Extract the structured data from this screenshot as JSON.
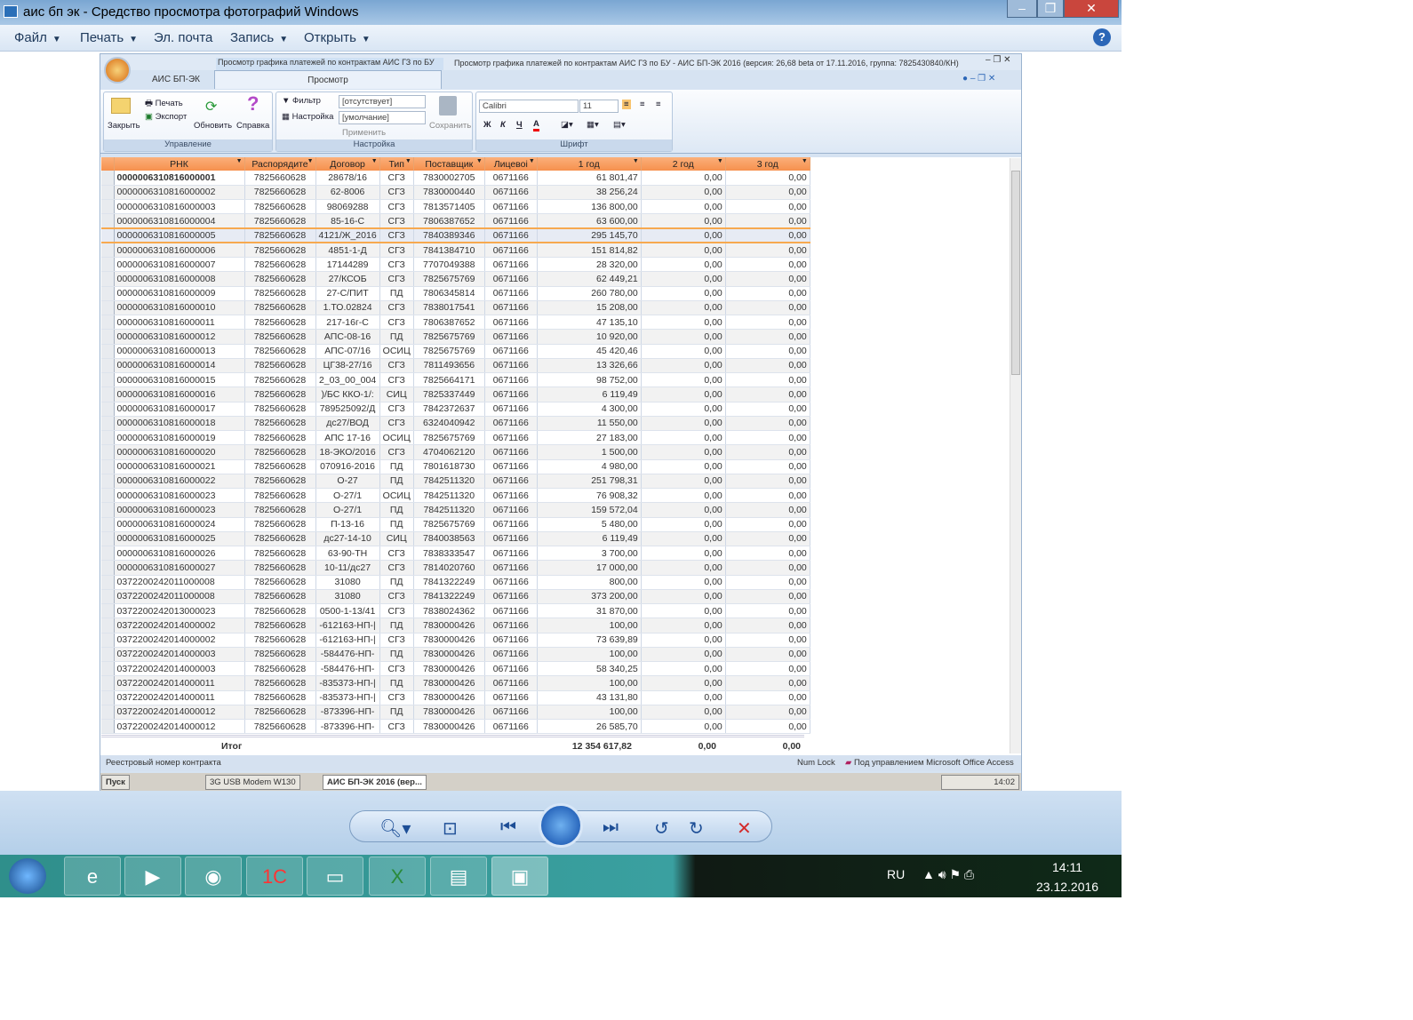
{
  "viewer": {
    "title": "аис бп эк - Средство просмотра фотографий Windows",
    "menu": [
      {
        "label": "Файл"
      },
      {
        "label": "Печать"
      },
      {
        "label": "Эл. почта"
      },
      {
        "label": "Запись"
      },
      {
        "label": "Открыть"
      }
    ]
  },
  "access": {
    "title_left": "Просмотр графика платежей по контрактам АИС ГЗ по БУ",
    "title_full": "Просмотр графика платежей по контрактам АИС ГЗ по БУ - АИС БП-ЭК 2016 (версия: 26,68 beta от 17.11.2016, группа: 7825430840/КН)",
    "tabs": [
      "АИС БП-ЭК",
      "Просмотр"
    ],
    "ribbon": {
      "manage": {
        "label": "Управление",
        "close": "Закрыть",
        "print": "Печать",
        "export": "Экспорт",
        "refresh": "Обновить",
        "help": "Справка"
      },
      "settings": {
        "label": "Настройка",
        "filter": "Фильтр",
        "filter_value": "[отсутствует]",
        "setup": "Настройка",
        "setup_value": "[умолчание]",
        "apply": "Применить",
        "save": "Сохранить"
      },
      "font": {
        "label": "Шрифт",
        "name": "Calibri",
        "size": "11",
        "bold": "Ж",
        "italic": "К",
        "underline": "Ч",
        "color": "А"
      }
    },
    "columns": [
      "РНК",
      "Распорядите",
      "Договор",
      "Тип",
      "Поставщик",
      "Лицевоі",
      "1 год",
      "2 год",
      "3 год"
    ],
    "rows": [
      [
        "0000006310816000001",
        "7825660628",
        "28678/16",
        "СГЗ",
        "7830002705",
        "0671166",
        "61 801,47",
        "0,00",
        "0,00"
      ],
      [
        "0000006310816000002",
        "7825660628",
        "62-8006",
        "СГЗ",
        "7830000440",
        "0671166",
        "38 256,24",
        "0,00",
        "0,00"
      ],
      [
        "0000006310816000003",
        "7825660628",
        "98069288",
        "СГЗ",
        "7813571405",
        "0671166",
        "136 800,00",
        "0,00",
        "0,00"
      ],
      [
        "0000006310816000004",
        "7825660628",
        "85-16-С",
        "СГЗ",
        "7806387652",
        "0671166",
        "63 600,00",
        "0,00",
        "0,00"
      ],
      [
        "0000006310816000005",
        "7825660628",
        "4121/Ж_2016",
        "СГЗ",
        "7840389346",
        "0671166",
        "295 145,70",
        "0,00",
        "0,00"
      ],
      [
        "0000006310816000006",
        "7825660628",
        "4851-1-Д",
        "СГЗ",
        "7841384710",
        "0671166",
        "151 814,82",
        "0,00",
        "0,00"
      ],
      [
        "0000006310816000007",
        "7825660628",
        "17144289",
        "СГЗ",
        "7707049388",
        "0671166",
        "28 320,00",
        "0,00",
        "0,00"
      ],
      [
        "0000006310816000008",
        "7825660628",
        "27/КСОБ",
        "СГЗ",
        "7825675769",
        "0671166",
        "62 449,21",
        "0,00",
        "0,00"
      ],
      [
        "0000006310816000009",
        "7825660628",
        "27-С/ПИТ",
        "ПД",
        "7806345814",
        "0671166",
        "260 780,00",
        "0,00",
        "0,00"
      ],
      [
        "0000006310816000010",
        "7825660628",
        "1.ТО.02824",
        "СГЗ",
        "7838017541",
        "0671166",
        "15 208,00",
        "0,00",
        "0,00"
      ],
      [
        "0000006310816000011",
        "7825660628",
        "217-16г-С",
        "СГЗ",
        "7806387652",
        "0671166",
        "47 135,10",
        "0,00",
        "0,00"
      ],
      [
        "0000006310816000012",
        "7825660628",
        "АПС-08-16",
        "ПД",
        "7825675769",
        "0671166",
        "10 920,00",
        "0,00",
        "0,00"
      ],
      [
        "0000006310816000013",
        "7825660628",
        "АПС-07/16",
        "ОСИЦ",
        "7825675769",
        "0671166",
        "45 420,46",
        "0,00",
        "0,00"
      ],
      [
        "0000006310816000014",
        "7825660628",
        "ЦГ38-27/16",
        "СГЗ",
        "7811493656",
        "0671166",
        "13 326,66",
        "0,00",
        "0,00"
      ],
      [
        "0000006310816000015",
        "7825660628",
        "2_03_00_004",
        "СГЗ",
        "7825664171",
        "0671166",
        "98 752,00",
        "0,00",
        "0,00"
      ],
      [
        "0000006310816000016",
        "7825660628",
        ")/БС ККО-1/:",
        "СИЦ",
        "7825337449",
        "0671166",
        "6 119,49",
        "0,00",
        "0,00"
      ],
      [
        "0000006310816000017",
        "7825660628",
        "789525092/Д",
        "СГЗ",
        "7842372637",
        "0671166",
        "4 300,00",
        "0,00",
        "0,00"
      ],
      [
        "0000006310816000018",
        "7825660628",
        "дс27/ВОД",
        "СГЗ",
        "6324040942",
        "0671166",
        "11 550,00",
        "0,00",
        "0,00"
      ],
      [
        "0000006310816000019",
        "7825660628",
        "АПС 17-16",
        "ОСИЦ",
        "7825675769",
        "0671166",
        "27 183,00",
        "0,00",
        "0,00"
      ],
      [
        "0000006310816000020",
        "7825660628",
        "18-ЭКО/2016",
        "СГЗ",
        "4704062120",
        "0671166",
        "1 500,00",
        "0,00",
        "0,00"
      ],
      [
        "0000006310816000021",
        "7825660628",
        "070916-2016",
        "ПД",
        "7801618730",
        "0671166",
        "4 980,00",
        "0,00",
        "0,00"
      ],
      [
        "0000006310816000022",
        "7825660628",
        "О-27",
        "ПД",
        "7842511320",
        "0671166",
        "251 798,31",
        "0,00",
        "0,00"
      ],
      [
        "0000006310816000023",
        "7825660628",
        "О-27/1",
        "ОСИЦ",
        "7842511320",
        "0671166",
        "76 908,32",
        "0,00",
        "0,00"
      ],
      [
        "0000006310816000023",
        "7825660628",
        "О-27/1",
        "ПД",
        "7842511320",
        "0671166",
        "159 572,04",
        "0,00",
        "0,00"
      ],
      [
        "0000006310816000024",
        "7825660628",
        "П-13-16",
        "ПД",
        "7825675769",
        "0671166",
        "5 480,00",
        "0,00",
        "0,00"
      ],
      [
        "0000006310816000025",
        "7825660628",
        "дс27-14-10",
        "СИЦ",
        "7840038563",
        "0671166",
        "6 119,49",
        "0,00",
        "0,00"
      ],
      [
        "0000006310816000026",
        "7825660628",
        "63-90-ТН",
        "СГЗ",
        "7838333547",
        "0671166",
        "3 700,00",
        "0,00",
        "0,00"
      ],
      [
        "0000006310816000027",
        "7825660628",
        "10-11/дс27",
        "СГЗ",
        "7814020760",
        "0671166",
        "17 000,00",
        "0,00",
        "0,00"
      ],
      [
        "0372200242011000008",
        "7825660628",
        "31080",
        "ПД",
        "7841322249",
        "0671166",
        "800,00",
        "0,00",
        "0,00"
      ],
      [
        "0372200242011000008",
        "7825660628",
        "31080",
        "СГЗ",
        "7841322249",
        "0671166",
        "373 200,00",
        "0,00",
        "0,00"
      ],
      [
        "0372200242013000023",
        "7825660628",
        "0500-1-13/41",
        "СГЗ",
        "7838024362",
        "0671166",
        "31 870,00",
        "0,00",
        "0,00"
      ],
      [
        "0372200242014000002",
        "7825660628",
        "-612163-НП-|",
        "ПД",
        "7830000426",
        "0671166",
        "100,00",
        "0,00",
        "0,00"
      ],
      [
        "0372200242014000002",
        "7825660628",
        "-612163-НП-|",
        "СГЗ",
        "7830000426",
        "0671166",
        "73 639,89",
        "0,00",
        "0,00"
      ],
      [
        "0372200242014000003",
        "7825660628",
        "-584476-НП-",
        "ПД",
        "7830000426",
        "0671166",
        "100,00",
        "0,00",
        "0,00"
      ],
      [
        "0372200242014000003",
        "7825660628",
        "-584476-НП-",
        "СГЗ",
        "7830000426",
        "0671166",
        "58 340,25",
        "0,00",
        "0,00"
      ],
      [
        "0372200242014000011",
        "7825660628",
        "-835373-НП-|",
        "ПД",
        "7830000426",
        "0671166",
        "100,00",
        "0,00",
        "0,00"
      ],
      [
        "0372200242014000011",
        "7825660628",
        "-835373-НП-|",
        "СГЗ",
        "7830000426",
        "0671166",
        "43 131,80",
        "0,00",
        "0,00"
      ],
      [
        "0372200242014000012",
        "7825660628",
        "-873396-НП-",
        "ПД",
        "7830000426",
        "0671166",
        "100,00",
        "0,00",
        "0,00"
      ],
      [
        "0372200242014000012",
        "7825660628",
        "-873396-НП-",
        "СГЗ",
        "7830000426",
        "0671166",
        "26 585,70",
        "0,00",
        "0,00"
      ]
    ],
    "selected_row": 5,
    "total": {
      "label": "Итог",
      "y1": "12 354 617,82",
      "y2": "0,00",
      "y3": "0,00"
    },
    "status_left": "Реестровый номер контракта",
    "status_numlock": "Num Lock",
    "status_right": "Под управлением Microsoft Office Access",
    "old_taskbar": {
      "start": "Пуск",
      "modem": "3G USB Modem W130",
      "app": "АИС БП-ЭК 2016 (вер...",
      "clock": "14:02"
    }
  },
  "taskbar": {
    "lang": "RU",
    "time": "14:11",
    "date": "23.12.2016"
  }
}
